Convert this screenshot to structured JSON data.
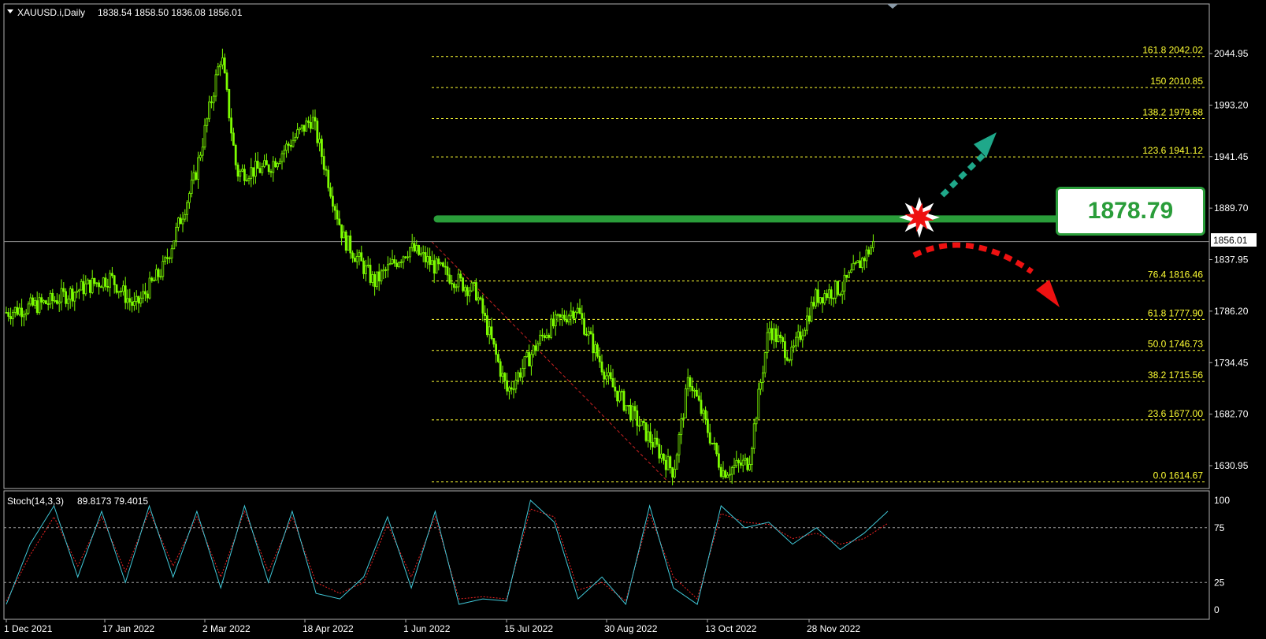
{
  "header": {
    "symbol": "XAUUSD.i,Daily",
    "ohlc": "1838.54 1858.50 1836.08 1856.01"
  },
  "stoch": {
    "label": "Stoch(14,3,3)",
    "values": "89.8173 79.4015",
    "axis": [
      "100",
      "75",
      "25",
      "0"
    ]
  },
  "annotation": {
    "resistance_price": "1878.79",
    "current_price": "1856.01"
  },
  "colors": {
    "candle": "#7CFC00",
    "fib": "#ffff33",
    "resistance": "#2a9d3a",
    "up_arrow": "#1fa88a",
    "down_arrow": "#ee1111",
    "stoch_main": "#40c8d8",
    "stoch_signal": "#ee2222"
  },
  "icons": [
    "collapse-triangle-icon",
    "explosion-icon",
    "up-arrow-icon",
    "down-arrow-icon"
  ],
  "chart_data": {
    "type": "candlestick",
    "title": "XAUUSD.i,Daily",
    "x_ticks": [
      "1 Dec 2021",
      "17 Jan 2022",
      "2 Mar 2022",
      "18 Apr 2022",
      "1 Jun 2022",
      "15 Jul 2022",
      "30 Aug 2022",
      "13 Oct 2022",
      "28 Nov 2022"
    ],
    "y_ticks": [
      "2044.95",
      "1993.20",
      "1941.45",
      "1889.70",
      "1837.95",
      "1786.20",
      "1734.45",
      "1682.70",
      "1630.95"
    ],
    "ylim": [
      1600,
      2070
    ],
    "price_path": [
      {
        "date": "2021-12-01",
        "close": 1785
      },
      {
        "date": "2021-12-20",
        "close": 1795
      },
      {
        "date": "2022-01-05",
        "close": 1810
      },
      {
        "date": "2022-01-17",
        "close": 1820
      },
      {
        "date": "2022-01-28",
        "close": 1790
      },
      {
        "date": "2022-02-10",
        "close": 1830
      },
      {
        "date": "2022-02-24",
        "close": 1920
      },
      {
        "date": "2022-03-08",
        "close": 2045
      },
      {
        "date": "2022-03-15",
        "close": 1925
      },
      {
        "date": "2022-03-29",
        "close": 1930
      },
      {
        "date": "2022-04-18",
        "close": 1980
      },
      {
        "date": "2022-05-02",
        "close": 1860
      },
      {
        "date": "2022-05-16",
        "close": 1815
      },
      {
        "date": "2022-06-01",
        "close": 1850
      },
      {
        "date": "2022-06-13",
        "close": 1830
      },
      {
        "date": "2022-07-01",
        "close": 1805
      },
      {
        "date": "2022-07-15",
        "close": 1705
      },
      {
        "date": "2022-08-01",
        "close": 1765
      },
      {
        "date": "2022-08-15",
        "close": 1790
      },
      {
        "date": "2022-08-30",
        "close": 1715
      },
      {
        "date": "2022-09-15",
        "close": 1665
      },
      {
        "date": "2022-09-28",
        "close": 1625
      },
      {
        "date": "2022-10-05",
        "close": 1720
      },
      {
        "date": "2022-10-20",
        "close": 1625
      },
      {
        "date": "2022-11-01",
        "close": 1635
      },
      {
        "date": "2022-11-10",
        "close": 1770
      },
      {
        "date": "2022-11-20",
        "close": 1740
      },
      {
        "date": "2022-12-01",
        "close": 1800
      },
      {
        "date": "2022-12-13",
        "close": 1810
      },
      {
        "date": "2022-12-28",
        "close": 1856
      }
    ],
    "fibonacci": [
      {
        "label": "161.8 2042.02",
        "price": 2042.02
      },
      {
        "label": "150 2010.85",
        "price": 2010.85
      },
      {
        "label": "138.2 1979.68",
        "price": 1979.68
      },
      {
        "label": "123.6 1941.12",
        "price": 1941.12
      },
      {
        "label": "76.4 1816.46",
        "price": 1816.46
      },
      {
        "label": "61.8 1777.90",
        "price": 1777.9
      },
      {
        "label": "50.0 1746.73",
        "price": 1746.73
      },
      {
        "label": "38.2 1715.56",
        "price": 1715.56
      },
      {
        "label": "23.6 1677.00",
        "price": 1677.0
      },
      {
        "label": "0.0 1614.67",
        "price": 1614.67
      }
    ],
    "resistance": 1878.79,
    "current_price": 1856.01,
    "stochastic": {
      "ylim": [
        0,
        100
      ],
      "levels": [
        75,
        25
      ],
      "main": [
        5,
        60,
        95,
        30,
        90,
        25,
        95,
        30,
        90,
        20,
        95,
        25,
        90,
        15,
        10,
        30,
        85,
        20,
        90,
        5,
        10,
        8,
        100,
        80,
        10,
        30,
        5,
        95,
        20,
        5,
        95,
        75,
        80,
        60,
        75,
        55,
        70,
        90
      ],
      "signal": [
        8,
        50,
        85,
        40,
        85,
        35,
        90,
        40,
        85,
        30,
        90,
        35,
        85,
        25,
        15,
        25,
        78,
        30,
        85,
        10,
        12,
        10,
        92,
        85,
        18,
        25,
        8,
        88,
        30,
        10,
        88,
        80,
        78,
        65,
        70,
        60,
        65,
        79
      ]
    }
  }
}
